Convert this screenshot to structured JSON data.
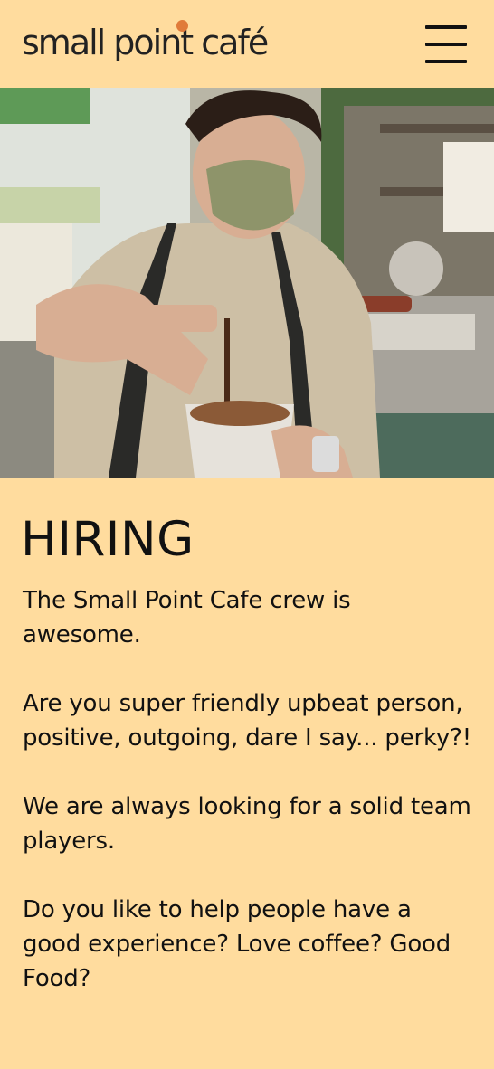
{
  "header": {
    "logo_text": "small point café",
    "menu_icon": "hamburger-menu-icon"
  },
  "hero": {
    "alt": "Barista in a face mask pouring espresso over an iced drink"
  },
  "main": {
    "heading": "HIRING",
    "paragraphs": [
      "The Small Point Cafe crew is awesome.",
      "Are you super friendly upbeat person, positive, outgoing, dare I say... perky?!",
      "We are always looking for a solid team players.",
      "Do you like to help people have a good experience? Love coffee? Good Food?"
    ]
  },
  "colors": {
    "background": "#ffdc9e",
    "logo_accent": "#e07b3a",
    "text": "#111111"
  }
}
